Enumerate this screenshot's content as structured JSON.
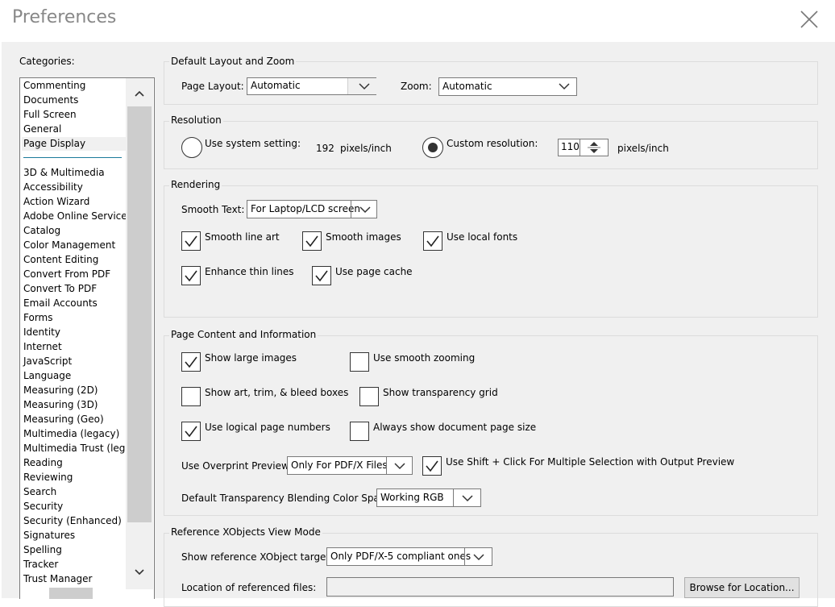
{
  "window": {
    "title": "Preferences"
  },
  "categories": {
    "label": "Categories:",
    "top_items": [
      "Commenting",
      "Documents",
      "Full Screen",
      "General",
      "Page Display"
    ],
    "selected": "Page Display",
    "items": [
      "3D & Multimedia",
      "Accessibility",
      "Action Wizard",
      "Adobe Online Services",
      "Catalog",
      "Color Management",
      "Content Editing",
      "Convert From PDF",
      "Convert To PDF",
      "Email Accounts",
      "Forms",
      "Identity",
      "Internet",
      "JavaScript",
      "Language",
      "Measuring (2D)",
      "Measuring (3D)",
      "Measuring (Geo)",
      "Multimedia (legacy)",
      "Multimedia Trust (legac",
      "Reading",
      "Reviewing",
      "Search",
      "Security",
      "Security (Enhanced)",
      "Signatures",
      "Spelling",
      "Tracker",
      "Trust Manager"
    ]
  },
  "layout_zoom": {
    "title": "Default Layout and Zoom",
    "page_layout_label": "Page Layout:",
    "page_layout_value": "Automatic",
    "zoom_label": "Zoom:",
    "zoom_value": "Automatic"
  },
  "resolution": {
    "title": "Resolution",
    "system_label": "Use system setting:",
    "system_value": "192",
    "system_unit": "pixels/inch",
    "custom_label": "Custom resolution:",
    "custom_value": "110",
    "custom_unit": "pixels/inch",
    "selected": "custom"
  },
  "rendering": {
    "title": "Rendering",
    "smooth_text_label": "Smooth Text:",
    "smooth_text_value": "For Laptop/LCD screen",
    "smooth_line_art": "Smooth line art",
    "smooth_images": "Smooth images",
    "use_local_fonts": "Use local fonts",
    "enhance_thin_lines": "Enhance thin lines",
    "use_page_cache": "Use page cache",
    "checked": {
      "smooth_line_art": true,
      "smooth_images": true,
      "use_local_fonts": true,
      "enhance_thin_lines": true,
      "use_page_cache": true
    }
  },
  "page_content": {
    "title": "Page Content and Information",
    "show_large_images": "Show large images",
    "use_smooth_zooming": "Use smooth zooming",
    "show_art_boxes": "Show art, trim, & bleed boxes",
    "show_transparency_grid": "Show transparency grid",
    "use_logical_page_numbers": "Use logical page numbers",
    "always_show_page_size": "Always show document page size",
    "overprint_label": "Use Overprint Preview:",
    "overprint_value": "Only For PDF/X Files",
    "shift_click_label": "Use Shift + Click For Multiple Selection with Output Preview",
    "blending_label": "Default Transparency Blending Color Space:",
    "blending_value": "Working RGB",
    "checked": {
      "show_large_images": true,
      "use_smooth_zooming": false,
      "show_art_boxes": false,
      "show_transparency_grid": false,
      "use_logical_page_numbers": true,
      "always_show_page_size": false,
      "shift_click": true
    }
  },
  "xobjects": {
    "title": "Reference XObjects View Mode",
    "targets_label": "Show reference XObject targets:",
    "targets_value": "Only PDF/X-5 compliant ones",
    "location_label": "Location of referenced files:",
    "location_value": "",
    "browse_label": "Browse for Location..."
  },
  "icons": {
    "close": "close-icon",
    "dropdown": "chevron-down-icon",
    "checkmark": "checkmark-icon",
    "spin": "spinner-arrows-icon"
  }
}
